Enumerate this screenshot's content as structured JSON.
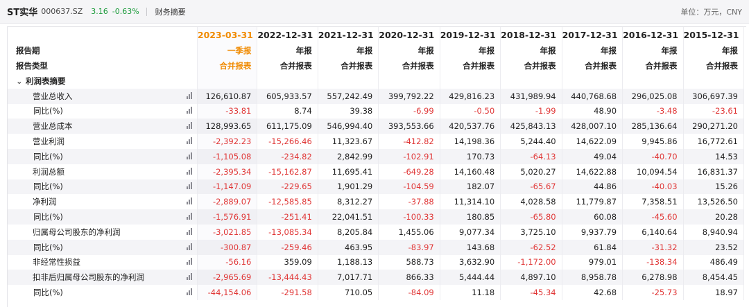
{
  "header": {
    "stock_name": "ST实华",
    "stock_code": "000637.SZ",
    "price": "3.16",
    "change_pct": "-0.63%",
    "tab_label": "财务摘要",
    "unit_label": "单位：万元，CNY"
  },
  "table": {
    "row_label_report_period": "报告期",
    "row_label_report_type": "报告类型",
    "section_title": "利润表摘要",
    "columns": [
      {
        "date": "2023-03-31",
        "period": "一季报",
        "type": "合并报表"
      },
      {
        "date": "2022-12-31",
        "period": "年报",
        "type": "合并报表"
      },
      {
        "date": "2021-12-31",
        "period": "年报",
        "type": "合并报表"
      },
      {
        "date": "2020-12-31",
        "period": "年报",
        "type": "合并报表"
      },
      {
        "date": "2019-12-31",
        "period": "年报",
        "type": "合并报表"
      },
      {
        "date": "2018-12-31",
        "period": "年报",
        "type": "合并报表"
      },
      {
        "date": "2017-12-31",
        "period": "年报",
        "type": "合并报表"
      },
      {
        "date": "2016-12-31",
        "period": "年报",
        "type": "合并报表"
      },
      {
        "date": "2015-12-31",
        "period": "年报",
        "type": "合并报表"
      }
    ],
    "rows": [
      {
        "label": "营业总收入",
        "sub": false,
        "values": [
          "126,610.87",
          "605,933.57",
          "557,242.49",
          "399,792.22",
          "429,816.23",
          "431,989.94",
          "440,768.68",
          "296,025.08",
          "306,697.39"
        ]
      },
      {
        "label": "同比(%)",
        "sub": true,
        "values": [
          "-33.81",
          "8.74",
          "39.38",
          "-6.99",
          "-0.50",
          "-1.99",
          "48.90",
          "-3.48",
          "-23.61"
        ]
      },
      {
        "label": "营业总成本",
        "sub": false,
        "values": [
          "128,993.65",
          "611,175.09",
          "546,994.40",
          "393,553.66",
          "420,537.76",
          "425,843.13",
          "428,007.10",
          "285,136.64",
          "290,271.20"
        ]
      },
      {
        "label": "营业利润",
        "sub": false,
        "values": [
          "-2,392.23",
          "-15,266.46",
          "11,323.67",
          "-412.82",
          "14,198.36",
          "5,244.40",
          "14,622.09",
          "9,945.86",
          "16,772.61"
        ]
      },
      {
        "label": "同比(%)",
        "sub": true,
        "values": [
          "-1,105.08",
          "-234.82",
          "2,842.99",
          "-102.91",
          "170.73",
          "-64.13",
          "49.04",
          "-40.70",
          "14.53"
        ]
      },
      {
        "label": "利润总额",
        "sub": false,
        "values": [
          "-2,395.34",
          "-15,162.87",
          "11,695.41",
          "-649.28",
          "14,160.48",
          "5,020.27",
          "14,622.88",
          "10,094.54",
          "16,831.37"
        ]
      },
      {
        "label": "同比(%)",
        "sub": true,
        "values": [
          "-1,147.09",
          "-229.65",
          "1,901.29",
          "-104.59",
          "182.07",
          "-65.67",
          "44.86",
          "-40.03",
          "15.26"
        ]
      },
      {
        "label": "净利润",
        "sub": false,
        "values": [
          "-2,889.07",
          "-12,585.85",
          "8,312.27",
          "-37.88",
          "11,314.10",
          "4,028.58",
          "11,779.87",
          "7,358.51",
          "13,526.50"
        ]
      },
      {
        "label": "同比(%)",
        "sub": true,
        "values": [
          "-1,576.91",
          "-251.41",
          "22,041.51",
          "-100.33",
          "180.85",
          "-65.80",
          "60.08",
          "-45.60",
          "20.28"
        ]
      },
      {
        "label": "归属母公司股东的净利润",
        "sub": false,
        "values": [
          "-3,021.85",
          "-13,085.34",
          "8,205.84",
          "1,455.06",
          "9,077.34",
          "3,725.10",
          "9,937.79",
          "6,140.64",
          "8,940.94"
        ]
      },
      {
        "label": "同比(%)",
        "sub": true,
        "values": [
          "-300.87",
          "-259.46",
          "463.95",
          "-83.97",
          "143.68",
          "-62.52",
          "61.84",
          "-31.32",
          "23.52"
        ]
      },
      {
        "label": "非经常性损益",
        "sub": false,
        "values": [
          "-56.16",
          "359.09",
          "1,188.13",
          "588.73",
          "3,632.90",
          "-1,172.00",
          "979.01",
          "-138.34",
          "486.49"
        ]
      },
      {
        "label": "扣非后归属母公司股东的净利润",
        "sub": false,
        "values": [
          "-2,965.69",
          "-13,444.43",
          "7,017.71",
          "866.33",
          "5,444.44",
          "4,897.10",
          "8,958.78",
          "6,278.98",
          "8,454.45"
        ]
      },
      {
        "label": "同比(%)",
        "sub": true,
        "values": [
          "-44,154.06",
          "-291.58",
          "710.05",
          "-84.09",
          "11.18",
          "-45.34",
          "42.68",
          "-25.73",
          "18.97"
        ]
      }
    ]
  },
  "icons": {
    "chart": "bar-chart-icon",
    "collapse": "chevron-down-icon"
  },
  "colors": {
    "highlight": "#f08a00",
    "negative": "#e03636",
    "up_down_green": "#1a9a3a"
  }
}
